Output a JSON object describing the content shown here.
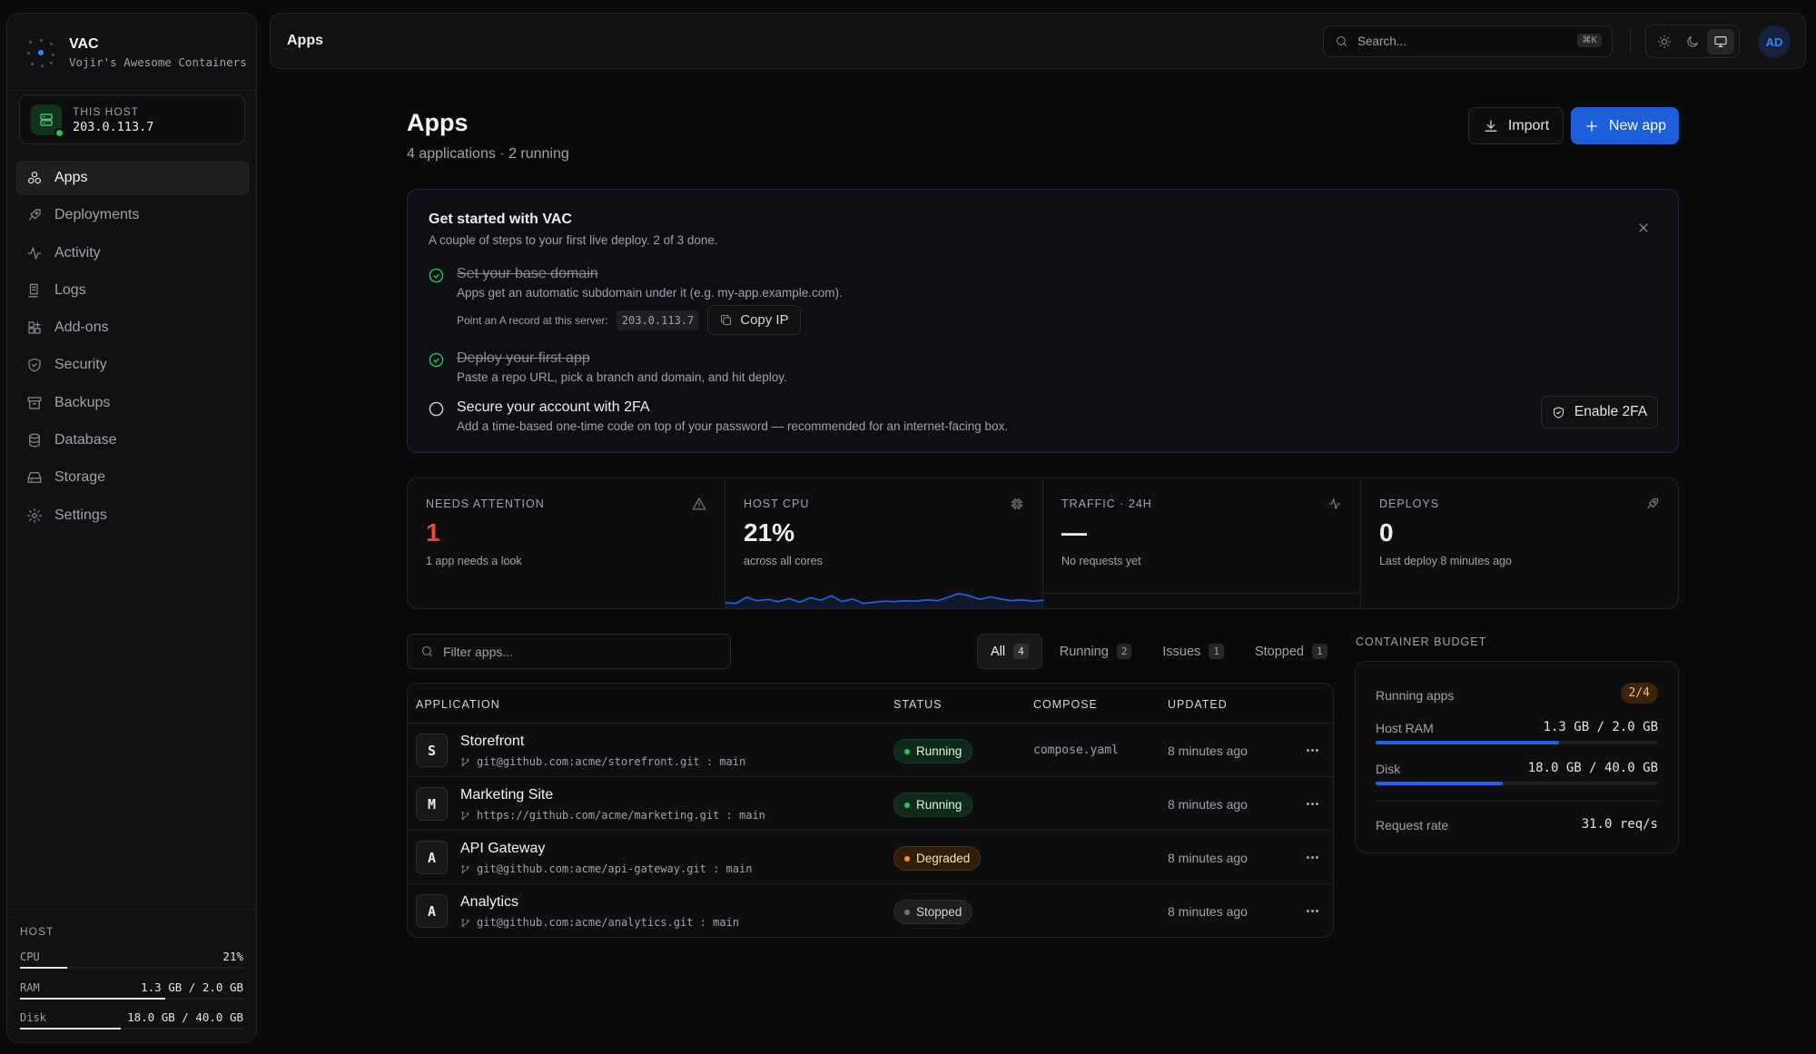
{
  "brand": {
    "name": "VAC",
    "subtitle": "Vojir's Awesome Containers"
  },
  "host_card": {
    "label": "THIS HOST",
    "ip": "203.0.113.7"
  },
  "nav": [
    {
      "label": "Apps",
      "icon": "apps-icon",
      "active": true
    },
    {
      "label": "Deployments",
      "icon": "rocket-icon"
    },
    {
      "label": "Activity",
      "icon": "activity-icon"
    },
    {
      "label": "Logs",
      "icon": "logs-icon"
    },
    {
      "label": "Add-ons",
      "icon": "addons-icon"
    },
    {
      "label": "Security",
      "icon": "shield-icon"
    },
    {
      "label": "Backups",
      "icon": "archive-icon"
    },
    {
      "label": "Database",
      "icon": "database-icon"
    },
    {
      "label": "Storage",
      "icon": "storage-icon"
    },
    {
      "label": "Settings",
      "icon": "gear-icon"
    }
  ],
  "host_stats": {
    "header": "HOST",
    "rows": [
      {
        "label": "CPU",
        "value": "21%",
        "fraction": 0.21
      },
      {
        "label": "RAM",
        "value": "1.3 GB / 2.0 GB",
        "fraction": 0.65
      },
      {
        "label": "Disk",
        "value": "18.0 GB / 40.0 GB",
        "fraction": 0.45
      }
    ]
  },
  "topbar": {
    "title": "Apps",
    "search_placeholder": "Search...",
    "search_shortcut": "⌘K",
    "avatar": "AD"
  },
  "page": {
    "title": "Apps",
    "subtitle": "4 applications · 2 running",
    "import_label": "Import",
    "new_app_label": "New app"
  },
  "getting_started": {
    "title": "Get started with VAC",
    "subtitle": "A couple of steps to your first live deploy. 2 of 3 done.",
    "steps": [
      {
        "title": "Set your base domain",
        "desc": "Apps get an automatic subdomain under it (e.g. my-app.example.com).",
        "done": true
      },
      {
        "title": "Deploy your first app",
        "desc": "Paste a repo URL, pick a branch and domain, and hit deploy.",
        "done": true
      },
      {
        "title": "Secure your account with 2FA",
        "desc": "Add a time-based one-time code on top of your password — recommended for an internet-facing box.",
        "done": false
      }
    ],
    "point_text": "Point an A record at this server:",
    "server_ip": "203.0.113.7",
    "copy_ip_label": "Copy IP",
    "enable_2fa_label": "Enable 2FA"
  },
  "stats": [
    {
      "label": "NEEDS ATTENTION",
      "value": "1",
      "caption": "1 app needs a look",
      "icon": "warning-icon",
      "value_color": "#ef4444"
    },
    {
      "label": "HOST CPU",
      "value": "21%",
      "caption": "across all cores",
      "icon": "cpu-icon"
    },
    {
      "label": "TRAFFIC · 24H",
      "value": "—",
      "caption": "No requests yet",
      "icon": "pulse-icon"
    },
    {
      "label": "DEPLOYS",
      "value": "0",
      "caption": "Last deploy 8 minutes ago",
      "icon": "rocket-icon"
    }
  ],
  "cpu_sparkline": [
    0.12,
    0.1,
    0.38,
    0.22,
    0.28,
    0.18,
    0.32,
    0.15,
    0.36,
    0.24,
    0.45,
    0.18,
    0.3,
    0.1,
    0.14,
    0.2,
    0.18,
    0.22,
    0.2,
    0.26,
    0.22,
    0.38,
    0.55,
    0.45,
    0.28,
    0.4,
    0.3,
    0.22,
    0.26,
    0.2,
    0.24
  ],
  "filter": {
    "placeholder": "Filter apps..."
  },
  "tabs": [
    {
      "label": "All",
      "count": "4",
      "active": true
    },
    {
      "label": "Running",
      "count": "2"
    },
    {
      "label": "Issues",
      "count": "1"
    },
    {
      "label": "Stopped",
      "count": "1"
    }
  ],
  "table": {
    "headers": {
      "application": "APPLICATION",
      "status": "STATUS",
      "compose": "COMPOSE",
      "updated": "UPDATED"
    },
    "rows": [
      {
        "initial": "S",
        "name": "Storefront",
        "repo": "git@github.com:acme/storefront.git : main",
        "status": "Running",
        "status_kind": "run",
        "compose": "compose.yaml",
        "updated": "8 minutes ago"
      },
      {
        "initial": "M",
        "name": "Marketing Site",
        "repo": "https://github.com/acme/marketing.git : main",
        "status": "Running",
        "status_kind": "run",
        "compose": "",
        "updated": "8 minutes ago"
      },
      {
        "initial": "A",
        "name": "API Gateway",
        "repo": "git@github.com:acme/api-gateway.git : main",
        "status": "Degraded",
        "status_kind": "deg",
        "compose": "",
        "updated": "8 minutes ago"
      },
      {
        "initial": "A",
        "name": "Analytics",
        "repo": "git@github.com:acme/analytics.git : main",
        "status": "Stopped",
        "status_kind": "stop",
        "compose": "",
        "updated": "8 minutes ago"
      }
    ]
  },
  "budget": {
    "header": "CONTAINER BUDGET",
    "running_label": "Running apps",
    "running_value": "2/4",
    "ram_label": "Host RAM",
    "ram_value": "1.3 GB / 2.0 GB",
    "ram_fraction": 0.65,
    "disk_label": "Disk",
    "disk_value": "18.0 GB / 40.0 GB",
    "disk_fraction": 0.45,
    "rate_label": "Request rate",
    "rate_value": "31.0 req/s"
  }
}
